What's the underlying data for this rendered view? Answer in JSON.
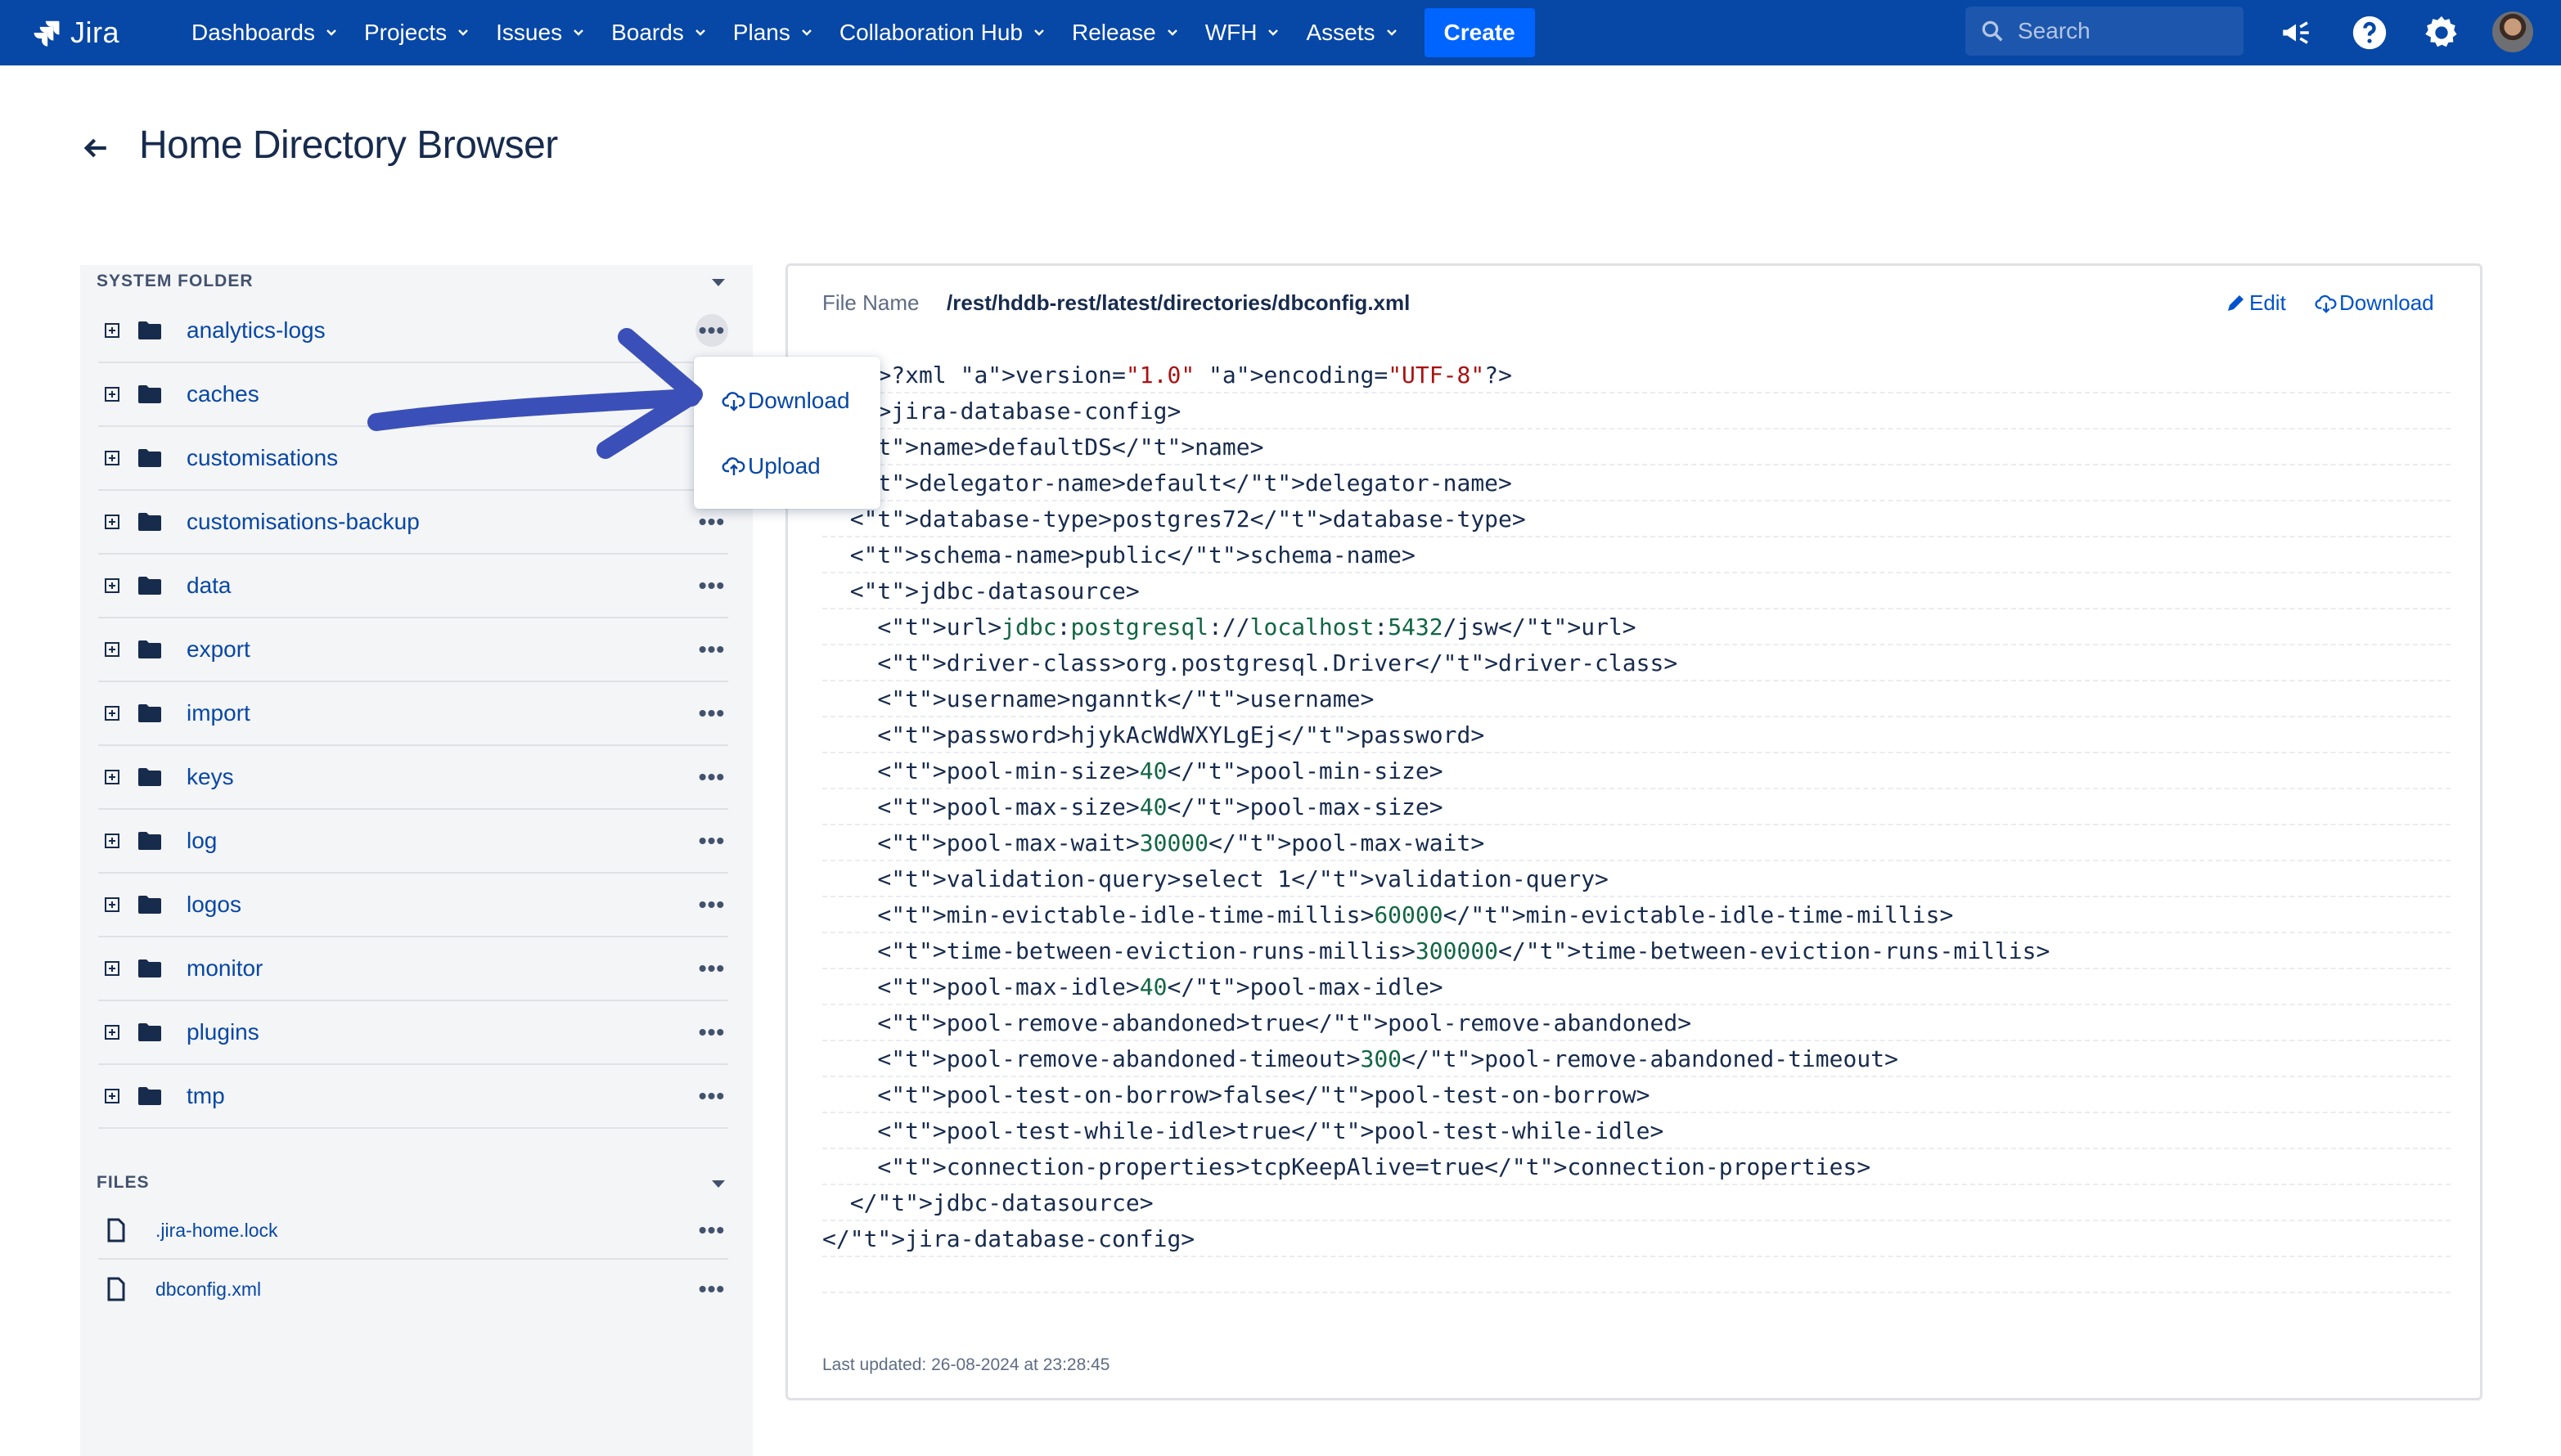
{
  "nav": {
    "logo_text": "Jira",
    "items": [
      "Dashboards",
      "Projects",
      "Issues",
      "Boards",
      "Plans",
      "Collaboration Hub",
      "Release",
      "WFH",
      "Assets"
    ],
    "create_label": "Create",
    "search_placeholder": "Search",
    "icons": [
      "megaphone-icon",
      "help-icon",
      "settings-icon",
      "avatar"
    ]
  },
  "page": {
    "title": "Home Directory Browser"
  },
  "sidebar": {
    "system_folder_heading": "SYSTEM FOLDER",
    "folders": [
      "analytics-logs",
      "caches",
      "customisations",
      "customisations-backup",
      "data",
      "export",
      "import",
      "keys",
      "log",
      "logos",
      "monitor",
      "plugins",
      "tmp"
    ],
    "files_heading": "FILES",
    "files": [
      ".jira-home.lock",
      "dbconfig.xml"
    ]
  },
  "context_menu": {
    "download_label": "Download",
    "upload_label": "Upload"
  },
  "viewer": {
    "file_name_label": "File Name",
    "file_path": "/rest/hddb-rest/latest/directories/dbconfig.xml",
    "edit_label": "Edit",
    "download_label": "Download",
    "code_lines": [
      "<?xml version=\"1.0\" encoding=\"UTF-8\"?>",
      "<jira-database-config>",
      "  <name>defaultDS</name>",
      "  <delegator-name>default</delegator-name>",
      "  <database-type>postgres72</database-type>",
      "  <schema-name>public</schema-name>",
      "  <jdbc-datasource>",
      "    <url>jdbc:postgresql://localhost:5432/jsw</url>",
      "    <driver-class>org.postgresql.Driver</driver-class>",
      "    <username>nganntk</username>",
      "    <password>hjykAcWdWXYLgEj</password>",
      "    <pool-min-size>40</pool-min-size>",
      "    <pool-max-size>40</pool-max-size>",
      "    <pool-max-wait>30000</pool-max-wait>",
      "    <validation-query>select 1</validation-query>",
      "    <min-evictable-idle-time-millis>60000</min-evictable-idle-time-millis>",
      "    <time-between-eviction-runs-millis>300000</time-between-eviction-runs-millis>",
      "    <pool-max-idle>40</pool-max-idle>",
      "    <pool-remove-abandoned>true</pool-remove-abandoned>",
      "    <pool-remove-abandoned-timeout>300</pool-remove-abandoned-timeout>",
      "    <pool-test-on-borrow>false</pool-test-on-borrow>",
      "    <pool-test-while-idle>true</pool-test-while-idle>",
      "    <connection-properties>tcpKeepAlive=true</connection-properties>",
      "  </jdbc-datasource>",
      "</jira-database-config>",
      ""
    ],
    "last_updated": "Last updated: 26-08-2024 at 23:28:45"
  },
  "colors": {
    "nav_bg": "#0747a6",
    "create_bg": "#0065ff",
    "link": "#0747a6",
    "annotation_arrow": "#3b4fb8"
  }
}
